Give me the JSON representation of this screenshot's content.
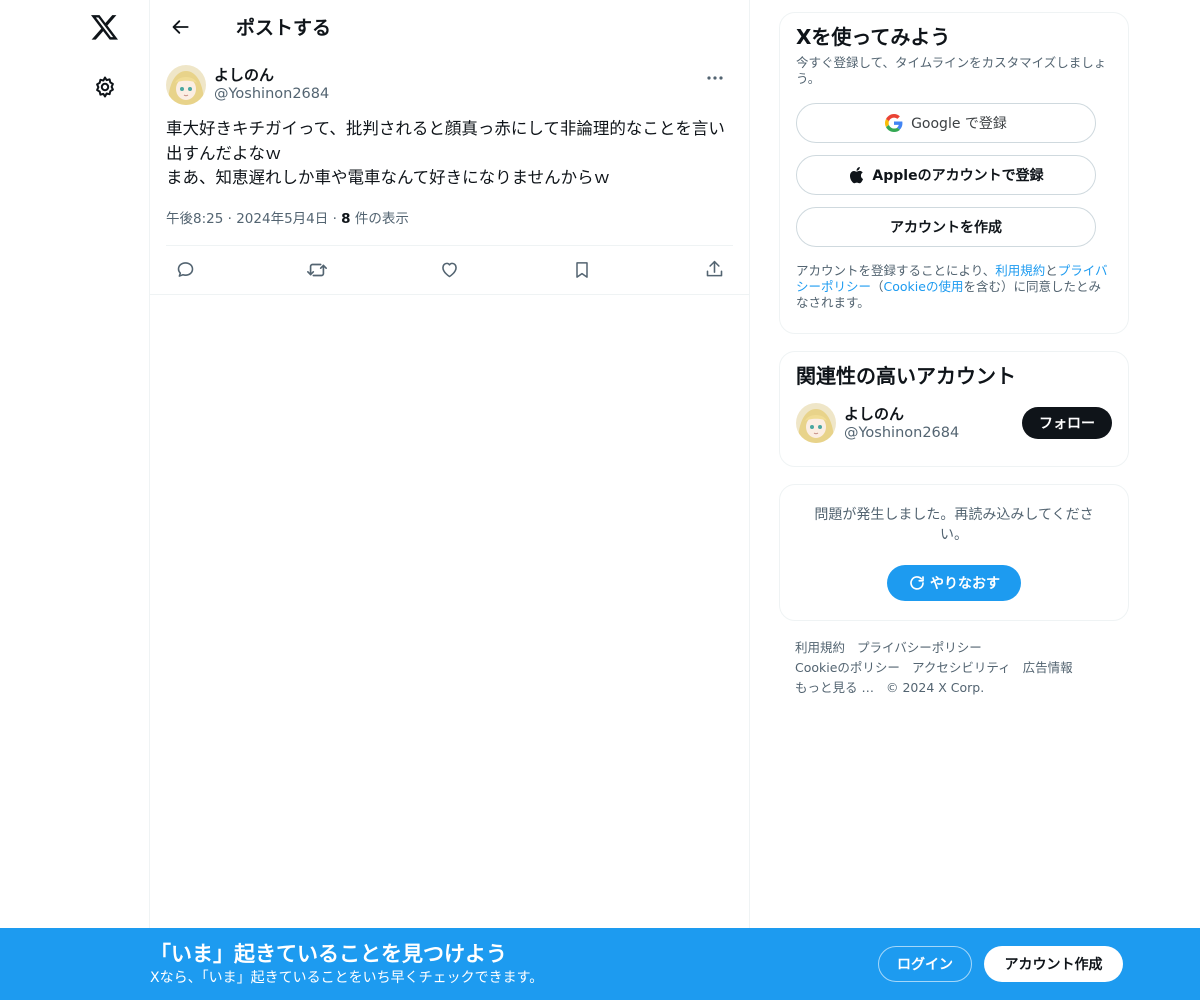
{
  "header": {
    "title": "ポストする"
  },
  "post": {
    "author_name": "よしのん",
    "author_handle": "@Yoshinon2684",
    "text": "車大好きキチガイって、批判されると顔真っ赤にして非論理的なことを言い出すんだよなｗ\nまあ、知恵遅れしか車や電車なんて好きになりませんからｗ",
    "time": "午後8:25",
    "date": "2024年5月4日",
    "views_count": "8",
    "views_label": "件の表示"
  },
  "signup": {
    "title": "Xを使ってみよう",
    "subtitle": "今すぐ登録して、タイムラインをカスタマイズしましょう。",
    "google_label": "Google で登録",
    "apple_label": "Appleのアカウントで登録",
    "create_label": "アカウントを作成",
    "legal_pre": "アカウントを登録することにより、",
    "legal_terms": "利用規約",
    "legal_and": "と",
    "legal_privacy": "プライバシーポリシー",
    "legal_paren_open": "（",
    "legal_cookie": "Cookieの使用",
    "legal_post": "を含む）に同意したとみなされます。"
  },
  "related": {
    "title": "関連性の高いアカウント",
    "name": "よしのん",
    "handle": "@Yoshinon2684",
    "follow_label": "フォロー"
  },
  "error_card": {
    "text": "問題が発生しました。再読み込みしてください。",
    "retry_label": "やりなおす"
  },
  "footer": {
    "links": [
      "利用規約",
      "プライバシーポリシー",
      "Cookieのポリシー",
      "アクセシビリティ",
      "広告情報",
      "もっと見る …",
      "© 2024 X Corp."
    ]
  },
  "banner": {
    "title": "「いま」起きていることを見つけよう",
    "subtitle": "Xなら、「いま」起きていることをいち早くチェックできます。",
    "login_label": "ログイン",
    "signup_label": "アカウント作成"
  },
  "colors": {
    "accent": "#1d9bf0",
    "text": "#0f1419",
    "secondary": "#536471",
    "border": "#eff3f4"
  }
}
